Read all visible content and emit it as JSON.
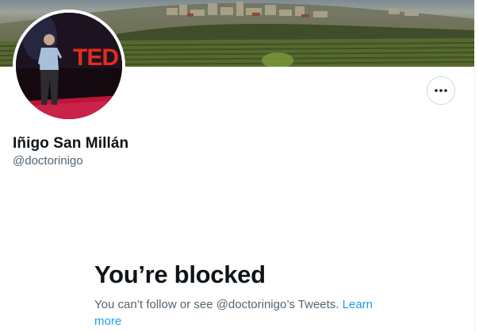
{
  "profile": {
    "display_name": "Iñigo San Millán",
    "handle": "@doctorinigo",
    "avatar_logo_text": "TED"
  },
  "more_button": {
    "icon": "more-horizontal-icon"
  },
  "blocked": {
    "title": "You’re blocked",
    "message": "You can’t follow or see @doctorinigo’s Tweets.",
    "learn_more": "Learn more"
  },
  "colors": {
    "text_primary": "#0f1419",
    "text_secondary": "#536471",
    "link": "#1d9bf0",
    "border": "#cfd9de",
    "ted_red": "#e62b1e"
  }
}
